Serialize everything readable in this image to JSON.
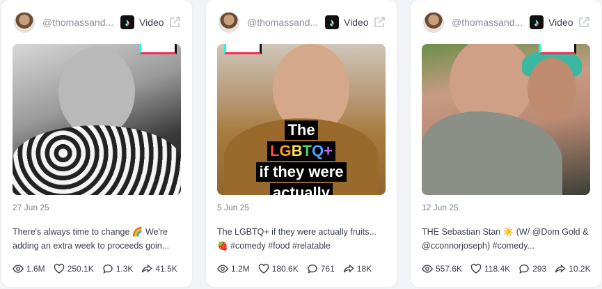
{
  "cards": [
    {
      "handle": "@thomassand...",
      "type_label": "Video",
      "date": "27 Jun 25",
      "desc_line1": "There's always time to change 🌈 We're",
      "desc_line2": "adding an extra week to proceeds goin...",
      "views": "1.6M",
      "likes": "250.1K",
      "comments": "1.3K",
      "shares": "41.5K"
    },
    {
      "handle": "@thomassand...",
      "type_label": "Video",
      "date": "5 Jun 25",
      "desc_line1": "The LGBTQ+ if they were actually fruits...",
      "desc_line2": "🍓 #comedy #food #relatable",
      "views": "1.2M",
      "likes": "180.6K",
      "comments": "761",
      "shares": "18K",
      "overlay": {
        "line1": "The",
        "line2": "LGBTQ+",
        "line3": "if they were",
        "line4": "actually"
      }
    },
    {
      "handle": "@thomassand...",
      "type_label": "Video",
      "date": "12 Jun 25",
      "desc_line1": "THE Sebastian Stan ☀️ (W/ @Dom Gold &",
      "desc_line2": "@cconnorjoseph) #comedy...",
      "views": "557.6K",
      "likes": "118.4K",
      "comments": "293",
      "shares": "10.2K"
    }
  ],
  "icons": {
    "platform": "tiktok-icon",
    "external": "external-link-icon",
    "views": "eye-icon",
    "likes": "heart-icon",
    "comments": "comment-icon",
    "shares": "share-icon"
  },
  "colors": {
    "muted_text": "#8a8f99",
    "body_text": "#3a3f4a",
    "card_bg": "#ffffff",
    "page_bg": "#f3f4f7"
  }
}
